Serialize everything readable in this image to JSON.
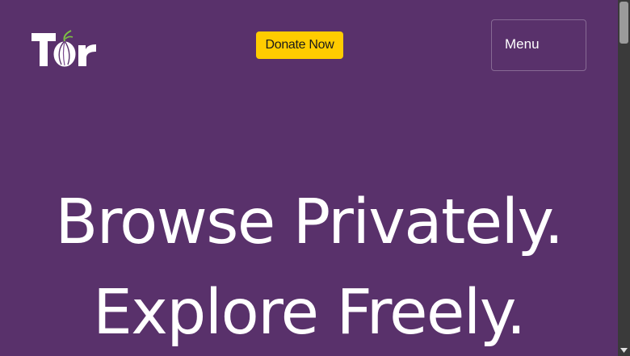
{
  "header": {
    "logo_text": "Tor",
    "donate_label": "Donate Now",
    "menu_label": "Menu"
  },
  "hero": {
    "line1": "Browse Privately.",
    "line2": "Explore Freely."
  },
  "colors": {
    "background": "#59316b",
    "donate_bg": "#ffcc00",
    "text": "#ffffff"
  },
  "icons": {
    "logo": "tor-onion-logo",
    "scroll_down": "triangle-down-icon"
  }
}
